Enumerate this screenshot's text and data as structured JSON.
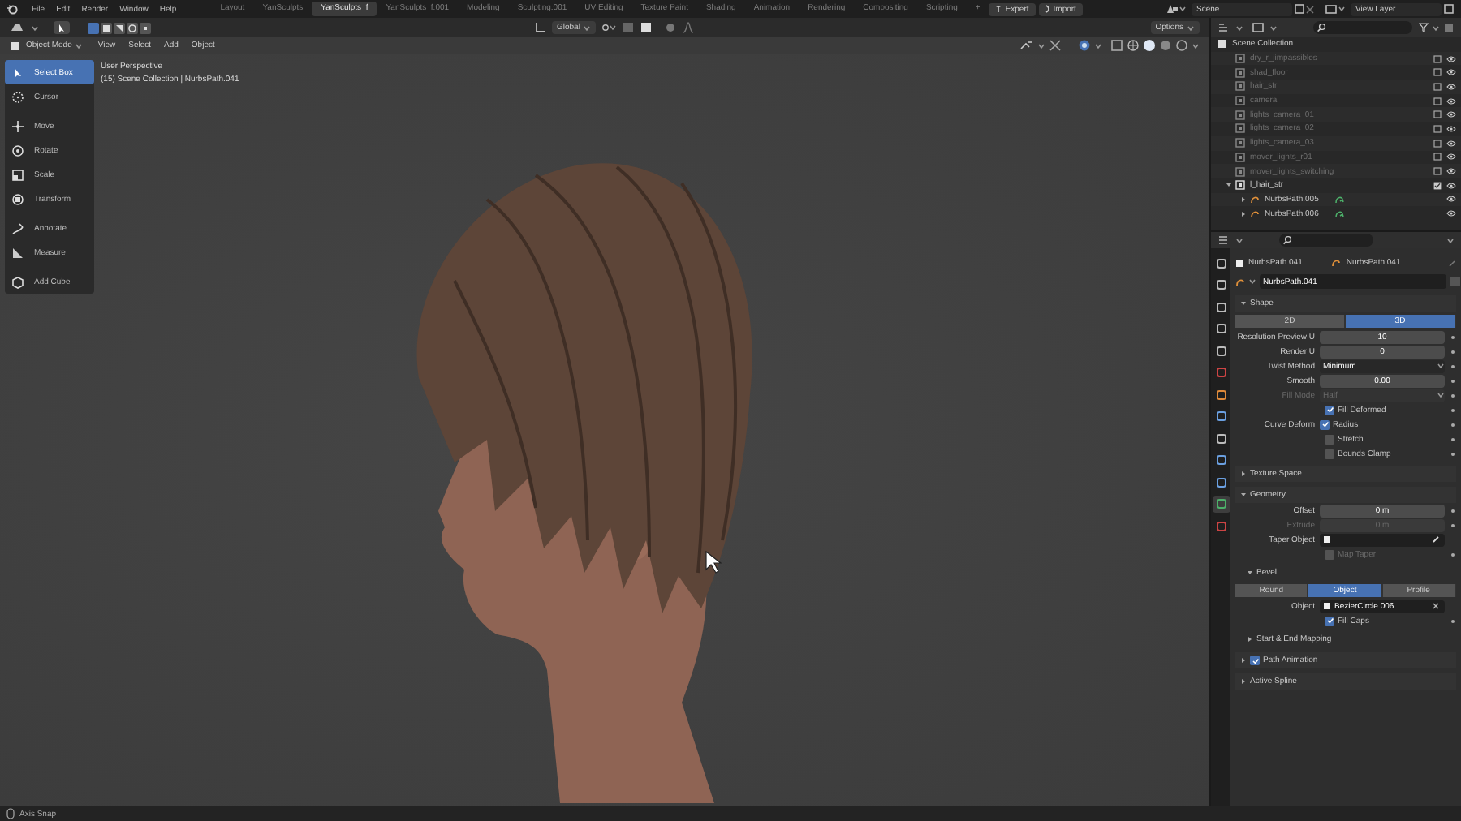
{
  "menu": [
    "File",
    "Edit",
    "Render",
    "Window",
    "Help"
  ],
  "workspaces": [
    {
      "label": "Layout",
      "selected": false
    },
    {
      "label": "YanSculpts",
      "selected": false
    },
    {
      "label": "YanSculpts_f",
      "selected": true
    },
    {
      "label": "YanSculpts_f.001",
      "selected": false
    },
    {
      "label": "Modeling",
      "selected": false
    },
    {
      "label": "Sculpting.001",
      "selected": false
    },
    {
      "label": "UV Editing",
      "selected": false
    },
    {
      "label": "Texture Paint",
      "selected": false
    },
    {
      "label": "Shading",
      "selected": false
    },
    {
      "label": "Animation",
      "selected": false
    },
    {
      "label": "Rendering",
      "selected": false
    },
    {
      "label": "Compositing",
      "selected": false
    },
    {
      "label": "Scripting",
      "selected": false
    }
  ],
  "add_workspace": "+",
  "workspace_actions": [
    "Expert",
    "Import"
  ],
  "scene": "Scene",
  "view_layer": "View Layer",
  "viewport": {
    "transform_orientation": "Global",
    "options": "Options",
    "mode": "Object Mode",
    "menus": [
      "View",
      "Select",
      "Add",
      "Object"
    ],
    "overlay": [
      "User Perspective",
      "(15) Scene Collection | NurbsPath.041"
    ]
  },
  "tools": [
    {
      "label": "Select Box",
      "kind": "select",
      "selected": true
    },
    {
      "label": "Cursor",
      "kind": "cursor",
      "selected": false
    },
    {
      "label": "Move",
      "kind": "move",
      "selected": false
    },
    {
      "label": "Rotate",
      "kind": "rotate",
      "selected": false
    },
    {
      "label": "Scale",
      "kind": "scale",
      "selected": false
    },
    {
      "label": "Transform",
      "kind": "transform",
      "selected": false
    },
    {
      "label": "Annotate",
      "kind": "annotate",
      "selected": false
    },
    {
      "label": "Measure",
      "kind": "measure",
      "selected": false
    },
    {
      "label": "Add Cube",
      "kind": "cube",
      "selected": false
    }
  ],
  "outliner": {
    "root": "Scene Collection",
    "items": [
      {
        "name": "dry_r_jimpassibles",
        "included": false
      },
      {
        "name": "shad_floor",
        "included": false
      },
      {
        "name": "hair_str",
        "included": false
      },
      {
        "name": "camera",
        "included": false
      },
      {
        "name": "lights_camera_01",
        "included": false
      },
      {
        "name": "lights_camera_02",
        "included": false
      },
      {
        "name": "lights_camera_03",
        "included": false
      },
      {
        "name": "mover_lights_r01",
        "included": false
      },
      {
        "name": "mover_lights_switching",
        "included": false
      },
      {
        "name": "l_hair_str",
        "included": true,
        "expanded": true,
        "children": [
          {
            "name": "NurbsPath.005",
            "expanded": false
          },
          {
            "name": "NurbsPath.006",
            "expanded": false
          }
        ]
      }
    ]
  },
  "properties": {
    "tabs": [
      {
        "kind": "tool",
        "selected": false
      },
      {
        "kind": "render",
        "selected": false
      },
      {
        "kind": "output",
        "selected": false
      },
      {
        "kind": "view",
        "selected": false
      },
      {
        "kind": "scene",
        "selected": false
      },
      {
        "kind": "world",
        "selected": false
      },
      {
        "kind": "object",
        "selected": false
      },
      {
        "kind": "modifier",
        "selected": false
      },
      {
        "kind": "particles",
        "selected": false
      },
      {
        "kind": "physics",
        "selected": false
      },
      {
        "kind": "constraints",
        "selected": false
      },
      {
        "kind": "data",
        "selected": true
      },
      {
        "kind": "texture",
        "selected": false
      }
    ],
    "object_name": "NurbsPath.041",
    "data_name": "NurbsPath.041",
    "datablock": "NurbsPath.041",
    "rows": [
      {
        "kind": "panel",
        "label": "Shape",
        "expanded": true
      },
      {
        "kind": "segmented",
        "options": [
          {
            "label": "2D",
            "selected": false
          },
          {
            "label": "3D",
            "selected": true
          }
        ]
      },
      {
        "kind": "number",
        "label": "Resolution Preview U",
        "value": "10",
        "disabled": false
      },
      {
        "kind": "number",
        "label": "Render U",
        "value": "0",
        "disabled": false
      },
      {
        "kind": "dropdown",
        "label": "Twist Method",
        "value": "Minimum",
        "disabled": false
      },
      {
        "kind": "number",
        "label": "Smooth",
        "value": "0.00",
        "disabled": false
      },
      {
        "kind": "dropdown",
        "label": "Fill Mode",
        "value": "Half",
        "disabled": true
      },
      {
        "kind": "checkbox",
        "text": "Fill Deformed",
        "checked": true,
        "disabled": false
      },
      {
        "kind": "checkbox",
        "label": "Curve Deform",
        "text": "Radius",
        "checked": true,
        "disabled": false
      },
      {
        "kind": "checkbox",
        "text": "Stretch",
        "checked": false,
        "disabled": false
      },
      {
        "kind": "checkbox",
        "text": "Bounds Clamp",
        "checked": false,
        "disabled": false
      },
      {
        "kind": "panel",
        "label": "Texture Space",
        "expanded": false
      },
      {
        "kind": "panel",
        "label": "Geometry",
        "expanded": true
      },
      {
        "kind": "number",
        "label": "Offset",
        "value": "0 m",
        "disabled": false
      },
      {
        "kind": "number",
        "label": "Extrude",
        "value": "0 m",
        "disabled": true
      },
      {
        "kind": "object",
        "label": "Taper Object",
        "disabled": false
      },
      {
        "kind": "checkbox",
        "text": "Map Taper",
        "checked": false,
        "disabled": true
      },
      {
        "kind": "subpanel",
        "label": "Bevel",
        "expanded": true
      },
      {
        "kind": "segmented",
        "options": [
          {
            "label": "Round",
            "selected": false
          },
          {
            "label": "Object",
            "selected": true
          },
          {
            "label": "Profile",
            "selected": false
          }
        ]
      },
      {
        "kind": "object",
        "label": "Object",
        "value": "BezierCircle.006",
        "disabled": false
      },
      {
        "kind": "checkbox",
        "text": "Fill Caps",
        "checked": true,
        "disabled": false
      },
      {
        "kind": "subpanel",
        "label": "Start & End Mapping",
        "expanded": false
      },
      {
        "kind": "panel",
        "label": "Path Animation",
        "expanded": false,
        "checked": true
      },
      {
        "kind": "panel",
        "label": "Active Spline",
        "expanded": false
      }
    ]
  },
  "status_bar": "Axis Snap"
}
